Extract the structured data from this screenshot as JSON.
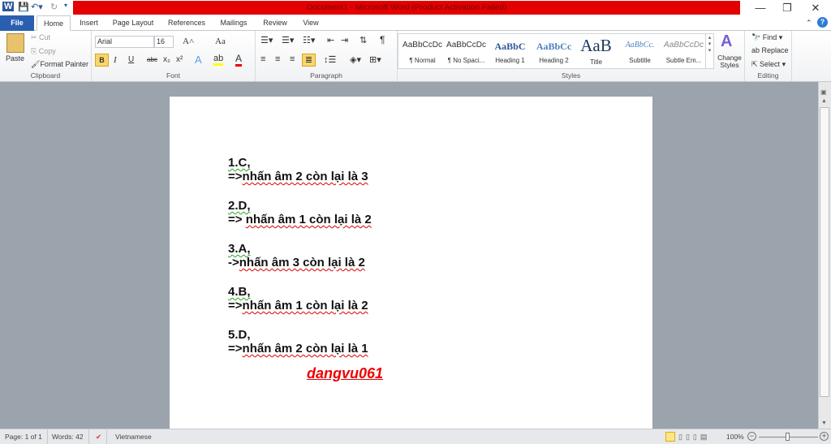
{
  "window": {
    "title": "Document1  -  Microsoft Word (Product Activation Failed)",
    "minimize": "—",
    "restore": "❐",
    "close": "✕",
    "help": "?"
  },
  "tabs": [
    "File",
    "Home",
    "Insert",
    "Page Layout",
    "References",
    "Mailings",
    "Review",
    "View"
  ],
  "clipboard": {
    "paste": "Paste",
    "cut": "Cut",
    "copy": "Copy",
    "format_painter": "Format Painter",
    "label": "Clipboard"
  },
  "font": {
    "name": "Arial",
    "size": "16",
    "bold": "B",
    "italic": "I",
    "underline": "U",
    "strike": "abc",
    "sub": "x₂",
    "sup": "x²",
    "grow": "A˄",
    "shrink": "A˅",
    "case": "Aa",
    "label": "Font"
  },
  "paragraph": {
    "label": "Paragraph",
    "pilcrow": "¶"
  },
  "styles": {
    "label": "Styles",
    "items": [
      {
        "sample": "AaBbCcDc",
        "name": "¶ Normal"
      },
      {
        "sample": "AaBbCcDc",
        "name": "¶ No Spaci..."
      },
      {
        "sample": "AaBbC",
        "name": "Heading 1"
      },
      {
        "sample": "AaBbCc",
        "name": "Heading 2"
      },
      {
        "sample": "AaB",
        "name": "Title"
      },
      {
        "sample": "AaBbCc.",
        "name": "Subtitle"
      },
      {
        "sample": "AaBbCcDc",
        "name": "Subtle Em..."
      }
    ],
    "change": "Change Styles"
  },
  "editing": {
    "find": "Find",
    "replace": "Replace",
    "select": "Select",
    "label": "Editing"
  },
  "document": {
    "lines": [
      {
        "head": "1.C,",
        "body_prefix": "=>",
        "body": "nhấn âm 2 còn lại là 3"
      },
      {
        "head": "2.D,",
        "body_prefix": "=> ",
        "body": "nhấn âm 1 còn lại là 2"
      },
      {
        "head": "3.A,",
        "body_prefix": "->",
        "body": "nhấn âm 3 còn lại là 2"
      },
      {
        "head": "4.B,",
        "body_prefix": "=>",
        "body": "nhấn âm 1 còn lại là 2"
      },
      {
        "head": "5.D,",
        "body_prefix": "=>",
        "body": "nhấn âm 2 còn lại là 1"
      }
    ],
    "signature": "dangvu061"
  },
  "status": {
    "page": "Page: 1 of 1",
    "words": "Words: 42",
    "language": "Vietnamese",
    "zoom": "100%",
    "zoom_percent": 100
  },
  "colors": {
    "title_bar": "#e40000",
    "file_tab": "#2a5fb0",
    "signature": "#ee0000"
  }
}
